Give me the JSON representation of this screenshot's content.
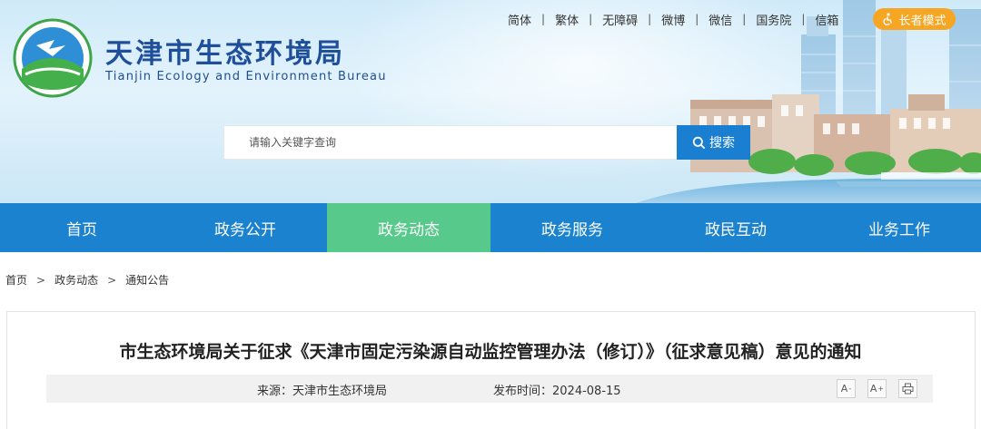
{
  "header": {
    "title": "天津市生态环境局",
    "subtitle": "Tianjin Ecology and Environment Bureau",
    "logo_text": "TIANJIN ECOLOGY ENVIRONMENT",
    "logo_bottom_text": "天津市生态环境局"
  },
  "top_links": [
    "简体",
    "繁体",
    "无障碍",
    "微博",
    "微信",
    "国务院",
    "信箱"
  ],
  "top_sep": "|",
  "elder_mode": {
    "label": "长者模式",
    "icon": "accessibility-icon"
  },
  "search": {
    "placeholder": "请输入关键字查询",
    "button_label": "搜索",
    "icon": "search-icon"
  },
  "nav": {
    "items": [
      "首页",
      "政务公开",
      "政务动态",
      "政务服务",
      "政民互动",
      "业务工作"
    ],
    "active_index": 2
  },
  "breadcrumb": {
    "items": [
      "首页",
      "政务动态",
      "通知公告"
    ],
    "separator": ">"
  },
  "article": {
    "title": "市生态环境局关于征求《天津市固定污染源自动监控管理办法（修订）》（征求意见稿）意见的通知",
    "source": "来源：天津市生态环境局",
    "publish": "发布时间：2024-08-15",
    "tools": {
      "font_smaller": "A",
      "font_larger": "A",
      "minus": "-",
      "plus": "+",
      "print_icon": "print-icon"
    }
  },
  "colors": {
    "nav_bg": "#1a82cf",
    "nav_active": "#57c98a",
    "brand_blue": "#1f4f9a",
    "elder_orange": "#f6a623",
    "search_btn": "#1a7fd0"
  }
}
